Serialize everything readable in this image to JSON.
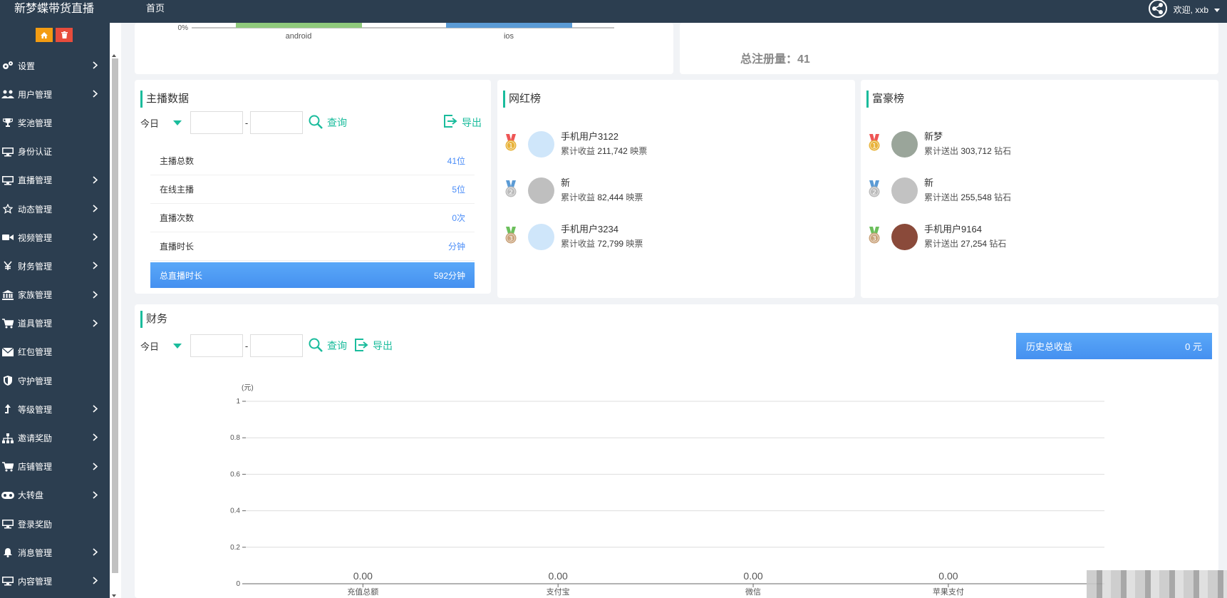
{
  "topbar": {
    "brand": "新梦蝶带货直播",
    "home": "首页",
    "welcome": "欢迎, xxb"
  },
  "sidebar": {
    "items": [
      {
        "label": "设置",
        "icon": "gears-icon",
        "arrow": true
      },
      {
        "label": "用户管理",
        "icon": "users-icon",
        "arrow": true
      },
      {
        "label": "奖池管理",
        "icon": "trophy-icon",
        "arrow": false
      },
      {
        "label": "身份认证",
        "icon": "monitor-icon",
        "arrow": false
      },
      {
        "label": "直播管理",
        "icon": "monitor-icon",
        "arrow": true
      },
      {
        "label": "动态管理",
        "icon": "star-icon",
        "arrow": true
      },
      {
        "label": "视频管理",
        "icon": "video-camera-icon",
        "arrow": true
      },
      {
        "label": "财务管理",
        "icon": "yen-icon",
        "arrow": true
      },
      {
        "label": "家族管理",
        "icon": "bank-icon",
        "arrow": true
      },
      {
        "label": "道具管理",
        "icon": "cart-icon",
        "arrow": true
      },
      {
        "label": "红包管理",
        "icon": "envelope-icon",
        "arrow": false
      },
      {
        "label": "守护管理",
        "icon": "shield-icon",
        "arrow": false
      },
      {
        "label": "等级管理",
        "icon": "level-up-icon",
        "arrow": true
      },
      {
        "label": "邀请奖励",
        "icon": "sitemap-icon",
        "arrow": true
      },
      {
        "label": "店铺管理",
        "icon": "cart-icon",
        "arrow": true
      },
      {
        "label": "大转盘",
        "icon": "gamepad-icon",
        "arrow": true
      },
      {
        "label": "登录奖励",
        "icon": "monitor-icon",
        "arrow": false
      },
      {
        "label": "消息管理",
        "icon": "bell-icon",
        "arrow": true
      },
      {
        "label": "内容管理",
        "icon": "monitor-icon",
        "arrow": true
      }
    ]
  },
  "device_chart": {
    "ytick": "0%",
    "categories": [
      "android",
      "ios"
    ],
    "colors": [
      "#8fca7c",
      "#5b9bd5"
    ]
  },
  "register": {
    "label": "总注册量：",
    "value": "41"
  },
  "anchor": {
    "title": "主播数据",
    "filter": {
      "select": "今日",
      "dash": "-",
      "query": "查询",
      "export": "导出"
    },
    "stats": [
      {
        "label": "主播总数",
        "value": "41位"
      },
      {
        "label": "在线主播",
        "value": "5位"
      },
      {
        "label": "直播次数",
        "value": "0次"
      },
      {
        "label": "直播时长",
        "value": "分钟"
      },
      {
        "label": "总直播时长",
        "value": "592分钟"
      }
    ]
  },
  "wanghong": {
    "title": "网红榜",
    "items": [
      {
        "name": "手机用户3122",
        "prefix": "累计收益",
        "amount": "211,742",
        "unit": "映票"
      },
      {
        "name": "新",
        "prefix": "累计收益",
        "amount": "82,444",
        "unit": "映票"
      },
      {
        "name": "手机用户3234",
        "prefix": "累计收益",
        "amount": "72,799",
        "unit": "映票"
      }
    ]
  },
  "fuhao": {
    "title": "富豪榜",
    "items": [
      {
        "name": "新梦",
        "prefix": "累计送出",
        "amount": "303,712",
        "unit": "钻石"
      },
      {
        "name": "新",
        "prefix": "累计送出",
        "amount": "255,548",
        "unit": "钻石"
      },
      {
        "name": "手机用户9164",
        "prefix": "累计送出",
        "amount": "27,254",
        "unit": "钻石"
      }
    ]
  },
  "finance": {
    "title": "财务",
    "filter": {
      "select": "今日",
      "dash": "-",
      "query": "查询",
      "export": "导出"
    },
    "history_label": "历史总收益",
    "history_value": "0 元"
  },
  "chart_data": {
    "type": "bar",
    "ylabel": "(元)",
    "categories": [
      "充值总额",
      "支付宝",
      "微信",
      "苹果支付"
    ],
    "values": [
      0,
      0,
      0,
      0
    ],
    "value_labels": [
      "0.00",
      "0.00",
      "0.00",
      "0.00"
    ],
    "ylim": [
      0,
      1
    ],
    "yticks": [
      "0",
      "0.2",
      "0.4",
      "0.6",
      "0.8",
      "1"
    ],
    "grid": true
  },
  "colors": {
    "accent": "#1abc9c",
    "sidebar": "#2c3e50",
    "highlight": "#4b8df8"
  }
}
